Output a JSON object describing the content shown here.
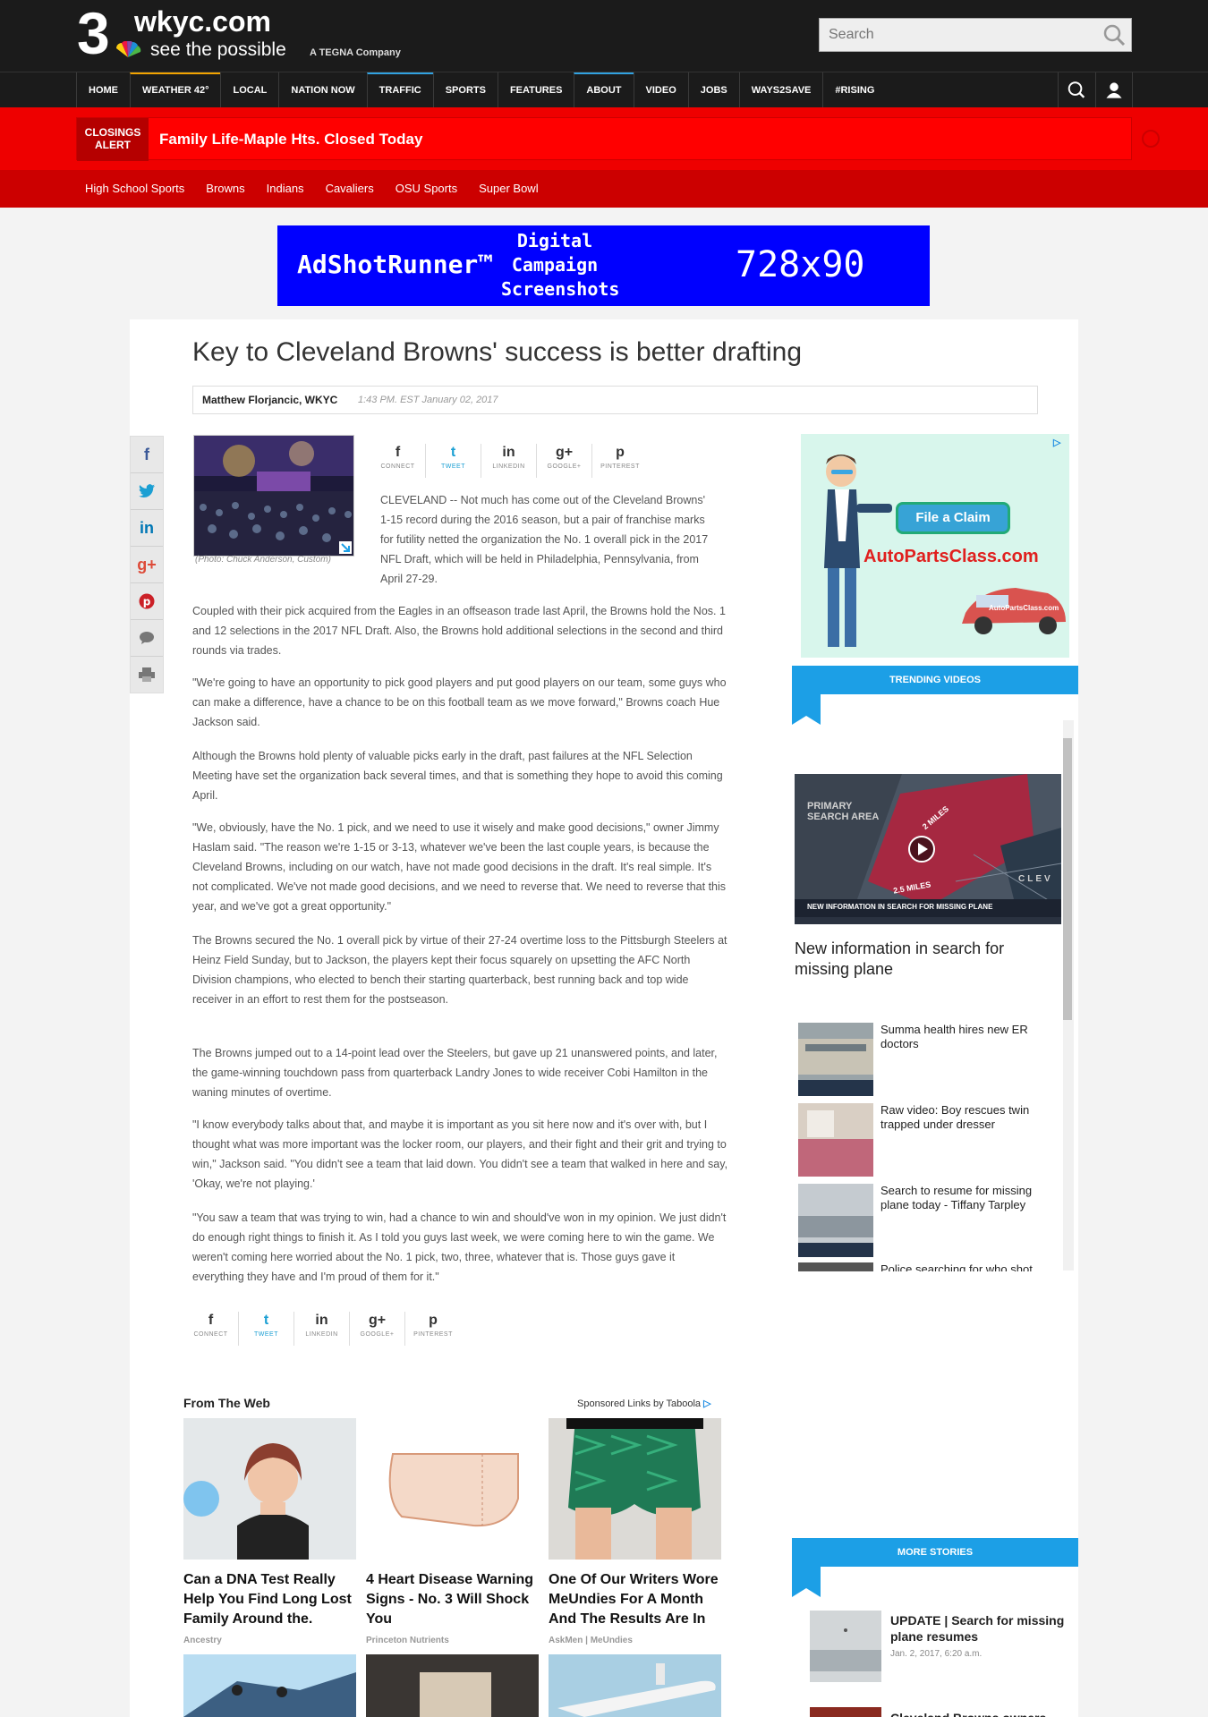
{
  "brand": {
    "channel_number": "3",
    "site": "wkyc.com",
    "tagline": "see the possible",
    "owner": "A TEGNA Company"
  },
  "search": {
    "placeholder": "Search"
  },
  "nav": {
    "items": [
      {
        "label": "HOME"
      },
      {
        "label": "WEATHER 42°"
      },
      {
        "label": "LOCAL"
      },
      {
        "label": "NATION NOW"
      },
      {
        "label": "TRAFFIC"
      },
      {
        "label": "SPORTS"
      },
      {
        "label": "FEATURES"
      },
      {
        "label": "ABOUT"
      },
      {
        "label": "VIDEO"
      },
      {
        "label": "JOBS"
      },
      {
        "label": "WAYS2SAVE"
      },
      {
        "label": "#RISING"
      }
    ]
  },
  "alert": {
    "badge_line1": "CLOSINGS",
    "badge_line2": "ALERT",
    "text": "Family Life-Maple Hts. Closed Today"
  },
  "subnav": {
    "items": [
      "High School Sports",
      "Browns",
      "Indians",
      "Cavaliers",
      "OSU Sports",
      "Super Bowl"
    ]
  },
  "top_ad": {
    "brand": "AdShotRunner™",
    "line1": "Digital",
    "line2": "Campaign",
    "line3": "Screenshots",
    "size": "728x90"
  },
  "article": {
    "headline": "Key to Cleveland Browns' success is better drafting",
    "author": "Matthew Florjancic, WKYC",
    "date": "1:43 PM. EST January 02, 2017",
    "photo_credit": "(Photo: Chuck Anderson, Custom)",
    "share": [
      {
        "glyph": "f",
        "label": "CONNECT"
      },
      {
        "glyph": "t",
        "label": "TWEET"
      },
      {
        "glyph": "in",
        "label": "LINKEDIN"
      },
      {
        "glyph": "g+",
        "label": "GOOGLE+"
      },
      {
        "glyph": "p",
        "label": "PINTEREST"
      }
    ],
    "paragraphs": [
      "CLEVELAND -- Not much has come out of the Cleveland Browns' 1-15 record during the 2016 season, but a pair of franchise marks for futility netted the organization the No. 1 overall pick in the 2017 NFL Draft, which will be held in Philadelphia, Pennsylvania, from April 27-29.",
      "Coupled with their pick acquired from the Eagles in an offseason trade last April, the Browns hold the Nos. 1 and 12 selections in the 2017 NFL Draft. Also, the Browns hold additional selections in the second and third rounds via trades.",
      "\"We're going to have an opportunity to pick good players and put good players on our team, some guys who can make a difference, have a chance to be on this football team as we move forward,\" Browns coach Hue Jackson said.",
      "Although the Browns hold plenty of valuable picks early in the draft, past failures at the NFL Selection Meeting have set the organization back several times, and that is something they hope to avoid this coming April.",
      "\"We, obviously, have the No. 1 pick, and we need to use it wisely and make good decisions,\" owner Jimmy Haslam said. \"The reason we're 1-15 or 3-13, whatever we've been the last couple years, is because the Cleveland Browns, including on our watch, have not made good decisions in the draft. It's real simple. It's not complicated. We've not made good decisions, and we need to reverse that. We need to reverse that this year, and we've got a great opportunity.\"",
      "The Browns secured the No. 1 overall pick by virtue of their 27-24 overtime loss to the Pittsburgh Steelers at Heinz Field Sunday, but to Jackson, the players kept their focus squarely on upsetting the AFC North Division champions, who elected to bench their starting quarterback, best running back and top wide receiver in an effort to rest them for the postseason.",
      "The Browns jumped out to a 14-point lead over the Steelers, but gave up 21 unanswered points, and later, the game-winning touchdown pass from quarterback Landry Jones to wide receiver Cobi Hamilton in the waning minutes of overtime.",
      "\"I know everybody talks about that, and maybe it is important as you sit here now and it's over with, but I thought what was more important was the locker room, our players, and their fight and their grit and trying to win,\" Jackson said. \"You didn't see a team that laid down. You didn't see a team that walked in here and say, 'Okay, we're not playing.'",
      "\"You saw a team that was trying to win, had a chance to win and should've won in my opinion. We just didn't do enough right things to finish it. As I told you guys last week, we were coming here to win the game. We weren't coming here worried about the No. 1 pick, two, three, whatever that is. Those guys gave it everything they have and I'm proud of them for it.\""
    ]
  },
  "right_ad": {
    "button": "File a Claim",
    "domain": "AutoPartsClass.com",
    "car_text": "AutoPartsClass.com"
  },
  "trending": {
    "title": "TRENDING VIDEOS",
    "video_overlay_line1": "PRIMARY",
    "video_overlay_line2": "SEARCH AREA",
    "video_map_label1": "2 MILES",
    "video_map_label2": "2.5 MILES",
    "video_map_city": "CLEV",
    "video_lower_third": "NEW INFORMATION IN SEARCH FOR MISSING PLANE",
    "video_caption": "New information in search for missing plane",
    "items": [
      {
        "title": "Summa health hires new ER doctors"
      },
      {
        "title": "Raw video: Boy rescues twin trapped under dresser"
      },
      {
        "title": "Search to resume for missing plane today - Tiffany Tarpley"
      },
      {
        "title": "Police searching for who shot"
      }
    ]
  },
  "more_stories": {
    "title": "MORE STORIES",
    "items": [
      {
        "title": "UPDATE | Search for missing plane resumes",
        "date": "Jan. 2, 2017, 6:20 a.m."
      },
      {
        "title": "Cleveland Browns owners",
        "date": ""
      }
    ]
  },
  "from_the_web": {
    "title": "From The Web",
    "sponsor": "Sponsored Links by Taboola",
    "cards": [
      {
        "title": "Can a DNA Test Really Help You Find Long Lost Family Around the.",
        "source": "Ancestry"
      },
      {
        "title": "4 Heart Disease Warning Signs - No. 3 Will Shock You",
        "source": "Princeton Nutrients"
      },
      {
        "title": "One Of Our Writers Wore MeUndies For A Month And The Results Are In",
        "source": "AskMen | MeUndies"
      }
    ]
  },
  "colors": {
    "header_bg": "#1b1b1b",
    "alert_red": "#ff0000",
    "subnav_red": "#cc0000",
    "accent_blue": "#1c9fe6",
    "ad_blue": "#0000ff"
  }
}
